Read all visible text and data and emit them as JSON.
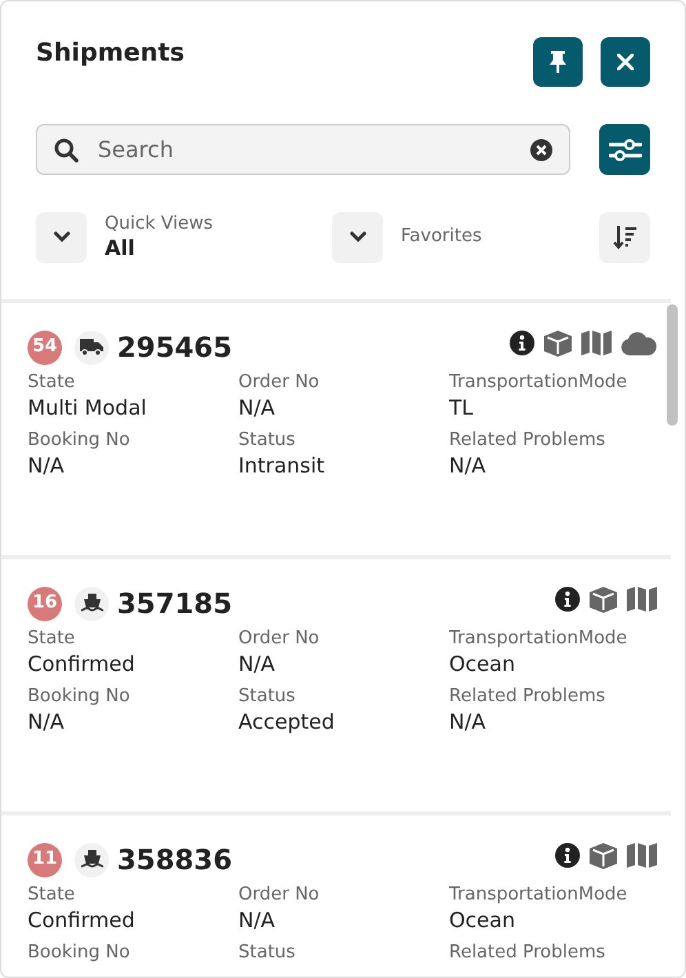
{
  "header": {
    "title": "Shipments"
  },
  "search": {
    "placeholder": "Search"
  },
  "filters": [
    {
      "label": "Quick Views",
      "value": "All"
    },
    {
      "label": "Favorites"
    }
  ],
  "shipments": [
    {
      "count": "54",
      "kind": "truck",
      "number": "295465",
      "icons": [
        {
          "kind": "info"
        },
        {
          "kind": "box"
        },
        {
          "kind": "map"
        },
        {
          "kind": "cloud"
        }
      ],
      "fields": [
        {
          "label": "State",
          "value": "Multi Modal"
        },
        {
          "label": "Order No",
          "value": "N/A"
        },
        {
          "label": "TransportationMode",
          "value": "TL"
        },
        {
          "label": "Booking No",
          "value": "N/A"
        },
        {
          "label": "Status",
          "value": "Intransit"
        },
        {
          "label": "Related Problems",
          "value": "N/A"
        }
      ]
    },
    {
      "count": "16",
      "kind": "ship",
      "number": "357185",
      "icons": [
        {
          "kind": "info"
        },
        {
          "kind": "box"
        },
        {
          "kind": "map"
        }
      ],
      "fields": [
        {
          "label": "State",
          "value": "Confirmed"
        },
        {
          "label": "Order No",
          "value": "N/A"
        },
        {
          "label": "TransportationMode",
          "value": "Ocean"
        },
        {
          "label": "Booking No",
          "value": "N/A"
        },
        {
          "label": "Status",
          "value": "Accepted"
        },
        {
          "label": "Related Problems",
          "value": "N/A"
        }
      ]
    },
    {
      "count": "11",
      "kind": "ship",
      "number": "358836",
      "icons": [
        {
          "kind": "info"
        },
        {
          "kind": "box"
        },
        {
          "kind": "map"
        }
      ],
      "fields": [
        {
          "label": "State",
          "value": "Confirmed"
        },
        {
          "label": "Order No",
          "value": "N/A"
        },
        {
          "label": "TransportationMode",
          "value": "Ocean"
        },
        {
          "label": "Booking No"
        },
        {
          "label": "Status"
        },
        {
          "label": "Related Problems"
        }
      ]
    }
  ]
}
